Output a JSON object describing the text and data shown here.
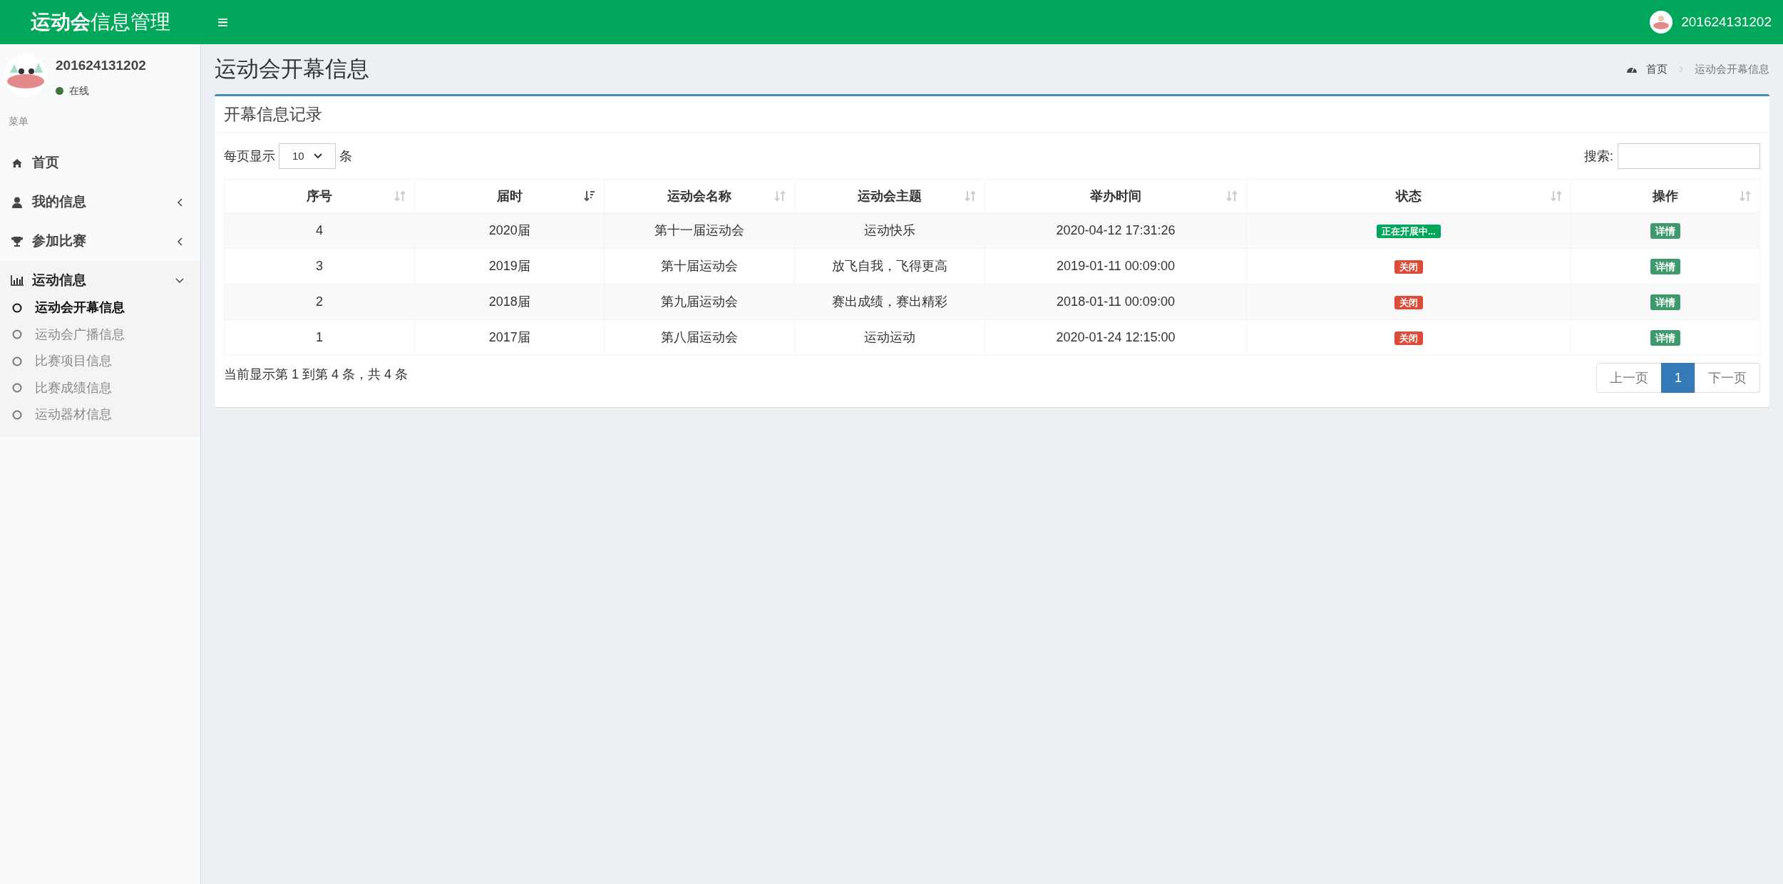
{
  "header": {
    "logo_bold": "运动会",
    "logo_rest": "信息管理",
    "menu_toggle": "≡",
    "user": "201624131202"
  },
  "sidebar": {
    "user": {
      "name": "201624131202",
      "status": "在线"
    },
    "menu_heading": "菜单",
    "items": [
      {
        "label": "首页",
        "selected": false
      },
      {
        "label": "我的信息",
        "selected": false,
        "expanded": false
      },
      {
        "label": "参加比赛",
        "selected": false,
        "expanded": false
      },
      {
        "label": "运动信息",
        "selected": true,
        "expanded": true,
        "children": [
          {
            "label": "运动会开幕信息",
            "selected": true
          },
          {
            "label": "运动会广播信息",
            "selected": false
          },
          {
            "label": "比赛项目信息",
            "selected": false
          },
          {
            "label": "比赛成绩信息",
            "selected": false
          },
          {
            "label": "运动器材信息",
            "selected": false
          }
        ]
      }
    ]
  },
  "page": {
    "title": "运动会开幕信息",
    "breadcrumb": [
      {
        "label": "首页"
      },
      {
        "label": "运动会开幕信息"
      }
    ]
  },
  "box": {
    "title": "开幕信息记录",
    "length_prefix": "每页显示",
    "length_value": "10",
    "length_suffix": "条",
    "search_label": "搜索:",
    "table": {
      "columns": [
        {
          "label": "序号",
          "sorted": false
        },
        {
          "label": "届时",
          "sorted": true
        },
        {
          "label": "运动会名称",
          "sorted": false
        },
        {
          "label": "运动会主题",
          "sorted": false
        },
        {
          "label": "举办时间",
          "sorted": false
        },
        {
          "label": "状态",
          "sorted": false
        },
        {
          "label": "操作",
          "sorted": false
        }
      ],
      "rows": [
        {
          "cells": [
            "4",
            "2020届",
            "第十一届运动会",
            "运动快乐",
            "2020-04-12 17:31:26"
          ],
          "status": {
            "label": "正在开展中...",
            "color": "#00a65a"
          },
          "action": "详情"
        },
        {
          "cells": [
            "3",
            "2019届",
            "第十届运动会",
            "放飞自我，飞得更高",
            "2019-01-11 00:09:00"
          ],
          "status": {
            "label": "关闭",
            "color": "#dd4b39"
          },
          "action": "详情"
        },
        {
          "cells": [
            "2",
            "2018届",
            "第九届运动会",
            "赛出成绩，赛出精彩",
            "2018-01-11 00:09:00"
          ],
          "status": {
            "label": "关闭",
            "color": "#dd4b39"
          },
          "action": "详情"
        },
        {
          "cells": [
            "1",
            "2017届",
            "第八届运动会",
            "运动运动",
            "2020-01-24 12:15:00"
          ],
          "status": {
            "label": "关闭",
            "color": "#dd4b39"
          },
          "action": "详情"
        }
      ]
    },
    "info": "当前显示第 1 到第 4 条，共 4 条",
    "pagination": [
      {
        "label": "上一页",
        "selected": false
      },
      {
        "label": "1",
        "selected": true
      },
      {
        "label": "下一页",
        "selected": false
      }
    ]
  }
}
